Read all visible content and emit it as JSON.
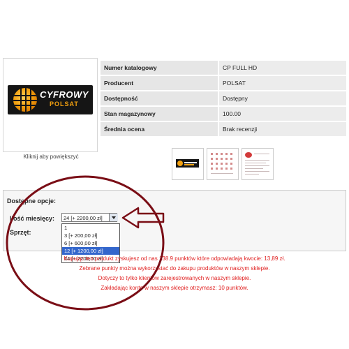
{
  "product": {
    "logo_title": "CYFROWY",
    "logo_sub": "POLSAT",
    "enlarge_text": "Kliknij aby powiększyć"
  },
  "info_rows": [
    {
      "label": "Numer katalogowy",
      "value": "CP FULL HD"
    },
    {
      "label": "Producent",
      "value": "POLSAT"
    },
    {
      "label": "Dostępność",
      "value": "Dostępny"
    },
    {
      "label": "Stan magazynowy",
      "value": "100.00"
    },
    {
      "label": "Średnia ocena",
      "value": "Brak recenzji"
    }
  ],
  "options": {
    "title": "Dostępne opcje:",
    "months_label": "Ilość miesięcy:",
    "hardware_label": "Sprzęt:",
    "selected_value": "24 [+ 2200,00 zł]",
    "dropdown_items": [
      {
        "label": "1",
        "selected": false
      },
      {
        "label": "3 [+ 200,00 zł]",
        "selected": false
      },
      {
        "label": "6 [+ 600,00 zł]",
        "selected": false
      },
      {
        "label": "12 [+ 1200,00 zł]",
        "selected": true
      },
      {
        "label": "24 [+ 2200,00 zł]",
        "selected": false
      }
    ]
  },
  "notice": {
    "line1": "Kupując ten produkt zyskujesz od nas 138.9 punktów które odpowiadają kwocie: 13,89 zł.",
    "line2": "Zebrane punkty można wykorzystać do zakupu produktów w naszym sklepie.",
    "line3": "Dotyczy to tylko klientów zarejestrowanych w naszym sklepie.",
    "line4": "Zakładając konto w naszym sklepie otrzymasz: 10 punktów."
  },
  "colors": {
    "annotation": "#7a0e16",
    "notice": "#e02020",
    "brand_orange": "#f4a10f",
    "selection": "#3366cc"
  }
}
